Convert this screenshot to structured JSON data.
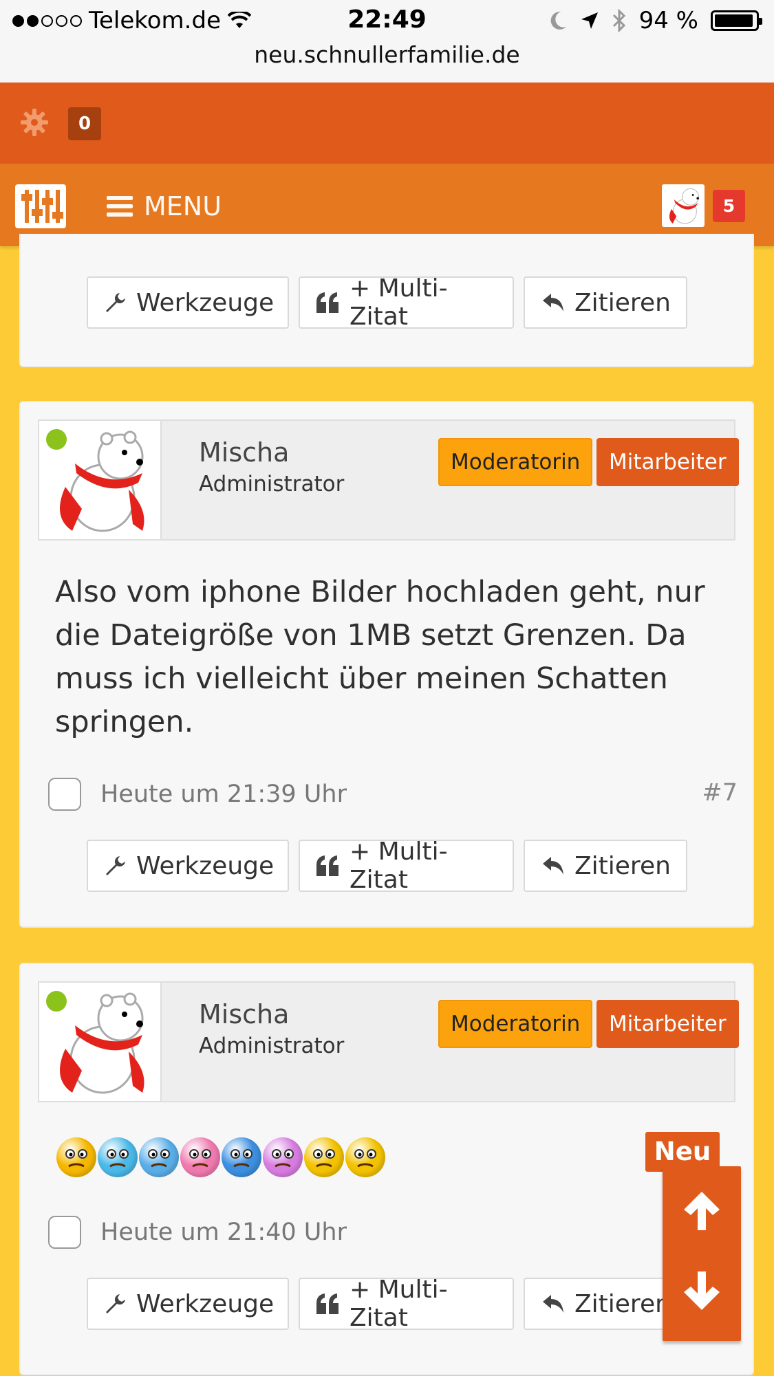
{
  "status_bar": {
    "carrier": "Telekom.de",
    "time": "22:49",
    "battery": "94 %",
    "battery_level": 0.94,
    "url": "neu.schnullerfamilie.de"
  },
  "top_bar": {
    "notification_count": "0"
  },
  "menu_bar": {
    "menu_label": "MENU",
    "user_badge_count": "5"
  },
  "actions": {
    "tools": "Werkzeuge",
    "multi_quote": "+ Multi-Zitat",
    "quote": "Zitieren"
  },
  "posts": [
    {
      "author": "Mischa",
      "role": "Administrator",
      "ranks": [
        "Moderatorin",
        "Mitarbeiter"
      ],
      "message": "Also vom iphone Bilder hochladen geht, nur die Dateigröße von 1MB setzt Grenzen. Da muss ich vielleicht über meinen Schatten springen.",
      "date": "Heute um 21:39 Uhr",
      "number": "#7"
    },
    {
      "author": "Mischa",
      "role": "Administrator",
      "ranks": [
        "Moderatorin",
        "Mitarbeiter"
      ],
      "smileys": [
        "sad-smiley",
        "rolling-eyes-smiley",
        "cool-smiley",
        "tongue-smiley",
        "shocked-smiley",
        "surprised-smiley",
        "skeptical-smiley",
        "confused-smiley"
      ],
      "smiley_colors": [
        "#f5b800",
        "#4bb8e8",
        "#5aaee8",
        "#f07ab0",
        "#3d8fe0",
        "#d77de0",
        "#f3c200",
        "#f3c200"
      ],
      "date": "Heute um 21:40 Uhr"
    }
  ],
  "floating_nav": {
    "new_label": "Neu"
  },
  "colors": {
    "page_background": "#fdcb35",
    "top_bar": "#df5a1b",
    "menu_bar": "#e6791f",
    "rank_moderator": "#fba20d",
    "rank_staff": "#df5a1b",
    "online": "#8bc21b"
  }
}
